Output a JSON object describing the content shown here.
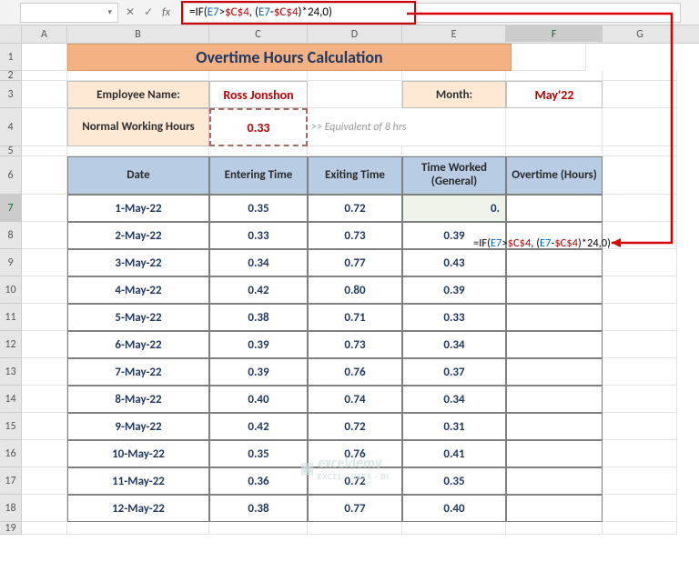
{
  "namebox": {
    "value": "",
    "chevron": "▾"
  },
  "fx": {
    "x": "✕",
    "check": "✓",
    "label": "fx"
  },
  "formula": {
    "p1": "=IF(",
    "p2": "E7",
    "p3": ">",
    "p4": "$C$4",
    "p5": ", (",
    "p6": "E7",
    "p7": "-",
    "p8": "$C$4",
    "p9": ")*24,0)"
  },
  "columns": {
    "A": "A",
    "B": "B",
    "C": "C",
    "D": "D",
    "E": "E",
    "F": "F",
    "G": "G"
  },
  "rows": [
    "1",
    "2",
    "3",
    "4",
    "5",
    "6",
    "7",
    "8",
    "9",
    "10",
    "11",
    "12",
    "13",
    "14",
    "15",
    "16",
    "17",
    "18",
    "19"
  ],
  "title": "Overtime Hours Calculation",
  "labels": {
    "employee": "Employee Name:",
    "normal_hours": "Normal Working Hours",
    "month": "Month:"
  },
  "values": {
    "employee": "Ross Jonshon",
    "normal_hours": "0.33",
    "month": "May'22",
    "note": ">> Equivalent of 8 hrs"
  },
  "headers": {
    "date": "Date",
    "enter": "Entering Time",
    "exit": "Exiting Time",
    "worked": "Time Worked (General)",
    "ot": "Overtime (Hours)"
  },
  "f7_prefix": "0.",
  "overlay_formula": {
    "p1": "=IF(",
    "p2": "E7",
    "p3": ">",
    "p4": "$C$4",
    "p5": ", (",
    "p6": "E7",
    "p7": "-",
    "p8": "$C$4",
    "p9": ")*24,0)"
  },
  "chart_data": {
    "type": "table",
    "columns": [
      "Date",
      "Entering Time",
      "Exiting Time",
      "Time Worked (General)"
    ],
    "rows": [
      {
        "date": "1-May-22",
        "enter": "0.35",
        "exit": "0.72",
        "worked": "0."
      },
      {
        "date": "2-May-22",
        "enter": "0.33",
        "exit": "0.73",
        "worked": "0.39"
      },
      {
        "date": "3-May-22",
        "enter": "0.34",
        "exit": "0.77",
        "worked": "0.43"
      },
      {
        "date": "4-May-22",
        "enter": "0.42",
        "exit": "0.80",
        "worked": "0.39"
      },
      {
        "date": "5-May-22",
        "enter": "0.38",
        "exit": "0.71",
        "worked": "0.33"
      },
      {
        "date": "6-May-22",
        "enter": "0.39",
        "exit": "0.73",
        "worked": "0.34"
      },
      {
        "date": "7-May-22",
        "enter": "0.39",
        "exit": "0.76",
        "worked": "0.37"
      },
      {
        "date": "8-May-22",
        "enter": "0.40",
        "exit": "0.74",
        "worked": "0.34"
      },
      {
        "date": "9-May-22",
        "enter": "0.42",
        "exit": "0.72",
        "worked": "0.31"
      },
      {
        "date": "10-May-22",
        "enter": "0.35",
        "exit": "0.76",
        "worked": "0.41"
      },
      {
        "date": "11-May-22",
        "enter": "0.36",
        "exit": "0.72",
        "worked": "0.35"
      },
      {
        "date": "12-May-22",
        "enter": "0.38",
        "exit": "0.77",
        "worked": "0.40"
      }
    ]
  },
  "watermark": {
    "brand": "exceldemy",
    "sub": "EXCEL · DATA · BI",
    "icon": "▣"
  }
}
